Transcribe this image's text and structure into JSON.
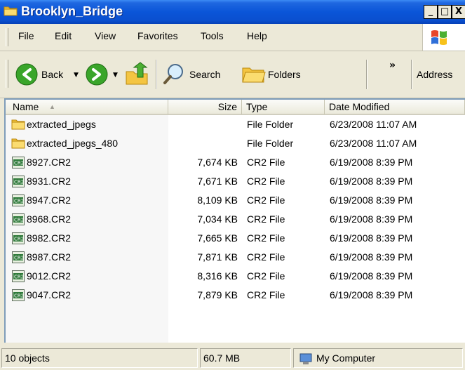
{
  "window": {
    "title": "Brooklyn_Bridge",
    "caption_buttons": {
      "minimize": "_",
      "maximize": "□",
      "close": "X"
    }
  },
  "menu": {
    "items": [
      "File",
      "Edit",
      "View",
      "Favorites",
      "Tools",
      "Help"
    ]
  },
  "toolbar": {
    "back_label": "Back",
    "search_label": "Search",
    "folders_label": "Folders",
    "chevron": "»",
    "address_label": "Address"
  },
  "columns": {
    "name": "Name",
    "size": "Size",
    "type": "Type",
    "date": "Date Modified",
    "sort_indicator": "▲"
  },
  "files": [
    {
      "name": "extracted_jpegs",
      "size": "",
      "type": "File Folder",
      "date": "6/23/2008 11:07 AM",
      "icon": "folder-icon"
    },
    {
      "name": "extracted_jpegs_480",
      "size": "",
      "type": "File Folder",
      "date": "6/23/2008 11:07 AM",
      "icon": "folder-icon"
    },
    {
      "name": "8927.CR2",
      "size": "7,674 KB",
      "type": "CR2 File",
      "date": "6/19/2008 8:39 PM",
      "icon": "cr2-file-icon"
    },
    {
      "name": "8931.CR2",
      "size": "7,671 KB",
      "type": "CR2 File",
      "date": "6/19/2008 8:39 PM",
      "icon": "cr2-file-icon"
    },
    {
      "name": "8947.CR2",
      "size": "8,109 KB",
      "type": "CR2 File",
      "date": "6/19/2008 8:39 PM",
      "icon": "cr2-file-icon"
    },
    {
      "name": "8968.CR2",
      "size": "7,034 KB",
      "type": "CR2 File",
      "date": "6/19/2008 8:39 PM",
      "icon": "cr2-file-icon"
    },
    {
      "name": "8982.CR2",
      "size": "7,665 KB",
      "type": "CR2 File",
      "date": "6/19/2008 8:39 PM",
      "icon": "cr2-file-icon"
    },
    {
      "name": "8987.CR2",
      "size": "7,871 KB",
      "type": "CR2 File",
      "date": "6/19/2008 8:39 PM",
      "icon": "cr2-file-icon"
    },
    {
      "name": "9012.CR2",
      "size": "8,316 KB",
      "type": "CR2 File",
      "date": "6/19/2008 8:39 PM",
      "icon": "cr2-file-icon"
    },
    {
      "name": "9047.CR2",
      "size": "7,879 KB",
      "type": "CR2 File",
      "date": "6/19/2008 8:39 PM",
      "icon": "cr2-file-icon"
    }
  ],
  "status": {
    "objects": "10 objects",
    "size": "60.7 MB",
    "zone": "My Computer"
  },
  "colors": {
    "titlebar": "#0a55d8",
    "accent": "#3a8a1e",
    "folder": "#f4c542"
  }
}
